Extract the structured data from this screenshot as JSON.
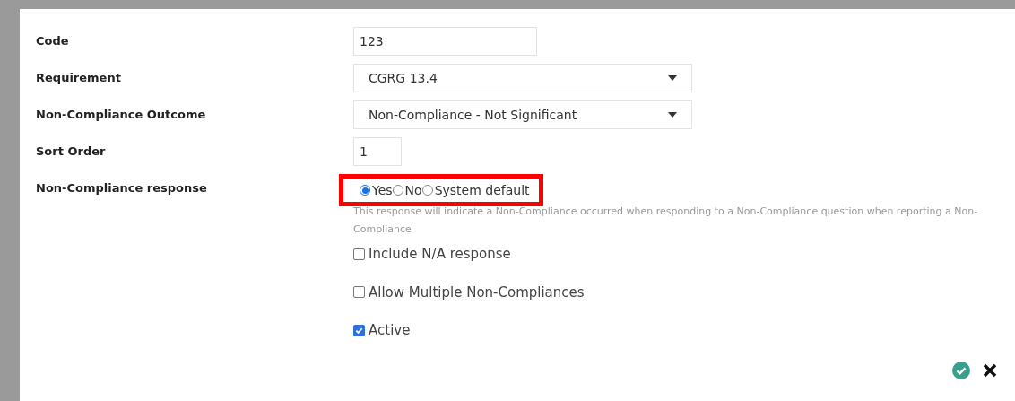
{
  "fields": [
    {
      "label": "Code",
      "kind": "text",
      "value": "123"
    },
    {
      "label": "Requirement",
      "kind": "select",
      "value": "CGRG 13.4"
    },
    {
      "label": "Non-Compliance Outcome",
      "kind": "select",
      "value": "Non-Compliance - Not Significant"
    },
    {
      "label": "Sort Order",
      "kind": "number",
      "value": "1"
    },
    {
      "label": "Non-Compliance response",
      "kind": "radio",
      "highlighted": true,
      "options": [
        {
          "label": "Yes",
          "selected": true
        },
        {
          "label": "No",
          "selected": false
        },
        {
          "label": "System default",
          "selected": false
        }
      ],
      "hint": "This response will indicate a Non-Compliance occurred when responding to a Non-Compliance question when reporting a Non-Compliance"
    }
  ],
  "checkboxes": [
    {
      "label": "Include N/A response",
      "checked": false
    },
    {
      "label": "Allow Multiple Non-Compliances",
      "checked": false
    },
    {
      "label": "Active",
      "checked": true
    }
  ],
  "actions": [
    {
      "kind": "save"
    },
    {
      "kind": "cancel"
    }
  ]
}
